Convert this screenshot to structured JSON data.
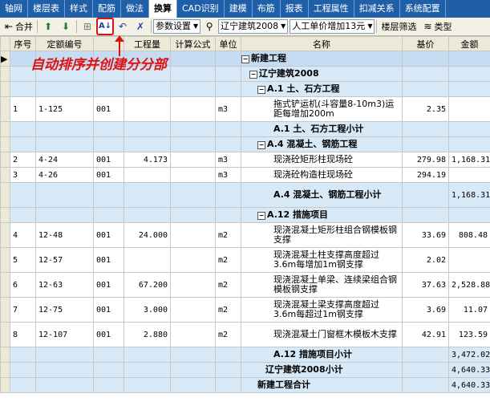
{
  "tabs": [
    "轴网",
    "楼层表",
    "样式",
    "配筋",
    "做法",
    "换算",
    "CAD识别",
    "建模",
    "布筋",
    "报表",
    "工程属性",
    "扣减关系",
    "系统配置"
  ],
  "active_tab": 5,
  "toolbar": {
    "merge_label": "合并",
    "param_combo": "参数设置",
    "quota_combo": "辽宁建筑2008",
    "price_combo": "人工单价增加13元",
    "floor_filter": "楼层筛选",
    "type_label": "类型"
  },
  "annotation": "自动排序并创建分分部",
  "columns": [
    "序号",
    "定额编号",
    "",
    "工程量",
    "计算公式",
    "单位",
    "名称",
    "基价",
    "金额"
  ],
  "rows": [
    {
      "type": "group",
      "indent": 0,
      "name": "新建工程",
      "price": "",
      "amount": "",
      "selected": true
    },
    {
      "type": "group",
      "indent": 1,
      "name": "辽宁建筑2008",
      "price": "",
      "amount": ""
    },
    {
      "type": "group",
      "indent": 2,
      "name": "A.1 土、石方工程",
      "price": "",
      "amount": ""
    },
    {
      "type": "item",
      "no": "1",
      "code": "1-125",
      "sub": "001",
      "qty": "",
      "formula": "",
      "unit": "m3",
      "name": "拖式铲运机(斗容量8-10m3)运距每增加200m",
      "price": "2.35",
      "amount": ""
    },
    {
      "type": "subtotal",
      "indent": 2,
      "name": "A.1 土、石方工程小计",
      "price": "",
      "amount": ""
    },
    {
      "type": "group",
      "indent": 2,
      "name": "A.4 混凝土、钢筋工程",
      "price": "",
      "amount": ""
    },
    {
      "type": "item",
      "no": "2",
      "code": "4-24",
      "sub": "001",
      "qty": "4.173",
      "formula": "",
      "unit": "m3",
      "name": "现浇砼矩形柱现场砼",
      "price": "279.98",
      "amount": "1,168.31"
    },
    {
      "type": "item",
      "no": "3",
      "code": "4-26",
      "sub": "001",
      "qty": "",
      "formula": "",
      "unit": "m3",
      "name": "现浇砼构造柱现场砼",
      "price": "294.19",
      "amount": ""
    },
    {
      "type": "subtotal",
      "indent": 2,
      "name": "A.4 混凝土、钢筋工程小计",
      "price": "",
      "amount": "1,168.31"
    },
    {
      "type": "group",
      "indent": 2,
      "name": "A.12 措施项目",
      "price": "",
      "amount": ""
    },
    {
      "type": "item",
      "no": "4",
      "code": "12-48",
      "sub": "001",
      "qty": "24.000",
      "formula": "",
      "unit": "m2",
      "name": "现浇混凝土矩形柱组合钢模板钢支撑",
      "price": "33.69",
      "amount": "808.48"
    },
    {
      "type": "item",
      "no": "5",
      "code": "12-57",
      "sub": "001",
      "qty": "",
      "formula": "",
      "unit": "m2",
      "name": "现浇混凝土柱支撑高度超过3.6m每增加1m钢支撑",
      "price": "2.02",
      "amount": ""
    },
    {
      "type": "item",
      "no": "6",
      "code": "12-63",
      "sub": "001",
      "qty": "67.200",
      "formula": "",
      "unit": "m2",
      "name": "现浇混凝土单梁、连续梁组合钢模板钢支撑",
      "price": "37.63",
      "amount": "2,528.88"
    },
    {
      "type": "item",
      "no": "7",
      "code": "12-75",
      "sub": "001",
      "qty": "3.000",
      "formula": "",
      "unit": "m2",
      "name": "现浇混凝土梁支撑高度超过3.6m每超过1m钢支撑",
      "price": "3.69",
      "amount": "11.07"
    },
    {
      "type": "item",
      "no": "8",
      "code": "12-107",
      "sub": "001",
      "qty": "2.880",
      "formula": "",
      "unit": "m2",
      "name": "现浇混凝土门窗框木模板木支撑",
      "price": "42.91",
      "amount": "123.59"
    },
    {
      "type": "subtotal",
      "indent": 2,
      "name": "A.12 措施项目小计",
      "price": "",
      "amount": "3,472.02"
    },
    {
      "type": "subtotal",
      "indent": 1,
      "name": "辽宁建筑2008小计",
      "price": "",
      "amount": "4,640.33"
    },
    {
      "type": "subtotal",
      "indent": 0,
      "name": "新建工程合计",
      "price": "",
      "amount": "4,640.33"
    }
  ],
  "colors": {
    "accent": "#1f5fa8",
    "annotation": "#e01010",
    "group_bg": "#d7e8f7"
  },
  "icons": {
    "merge": "merge-icon",
    "up": "move-up-icon",
    "down": "move-down-icon",
    "sort": "sort-az-icon",
    "undo": "undo-icon",
    "delete": "delete-icon",
    "search": "binoculars-icon"
  }
}
